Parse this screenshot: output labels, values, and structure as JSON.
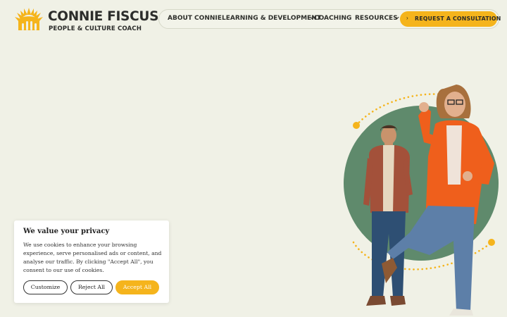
{
  "brand": {
    "name": "CONNIE FISCUS",
    "tagline": "PEOPLE & CULTURE COACH",
    "logo_icon": "sunflower-logo-icon",
    "color": "#f5b41c"
  },
  "nav": {
    "items": [
      {
        "label": "ABOUT CONNIE",
        "dropdown": false
      },
      {
        "label": "LEARNING & DEVELOPMENT",
        "dropdown": true
      },
      {
        "label": "COACHING",
        "dropdown": false
      },
      {
        "label": "RESOURCES",
        "dropdown": true
      }
    ],
    "cta": {
      "icon": "arrow-right-icon",
      "arrow": "›",
      "label": "REQUEST A CONSULTATION"
    }
  },
  "hero": {
    "image": "photo-two-people-posing",
    "circle_color": "#5f8a6c",
    "dots_color": "#f5b41c"
  },
  "cookie_banner": {
    "title": "We value your privacy",
    "text": "We use cookies to enhance your browsing experience, serve personalised ads or content, and analyse our traffic. By clicking \"Accept All\", you consent to our use of cookies.",
    "buttons": {
      "customize": "Customize",
      "reject": "Reject All",
      "accept": "Accept All"
    }
  }
}
